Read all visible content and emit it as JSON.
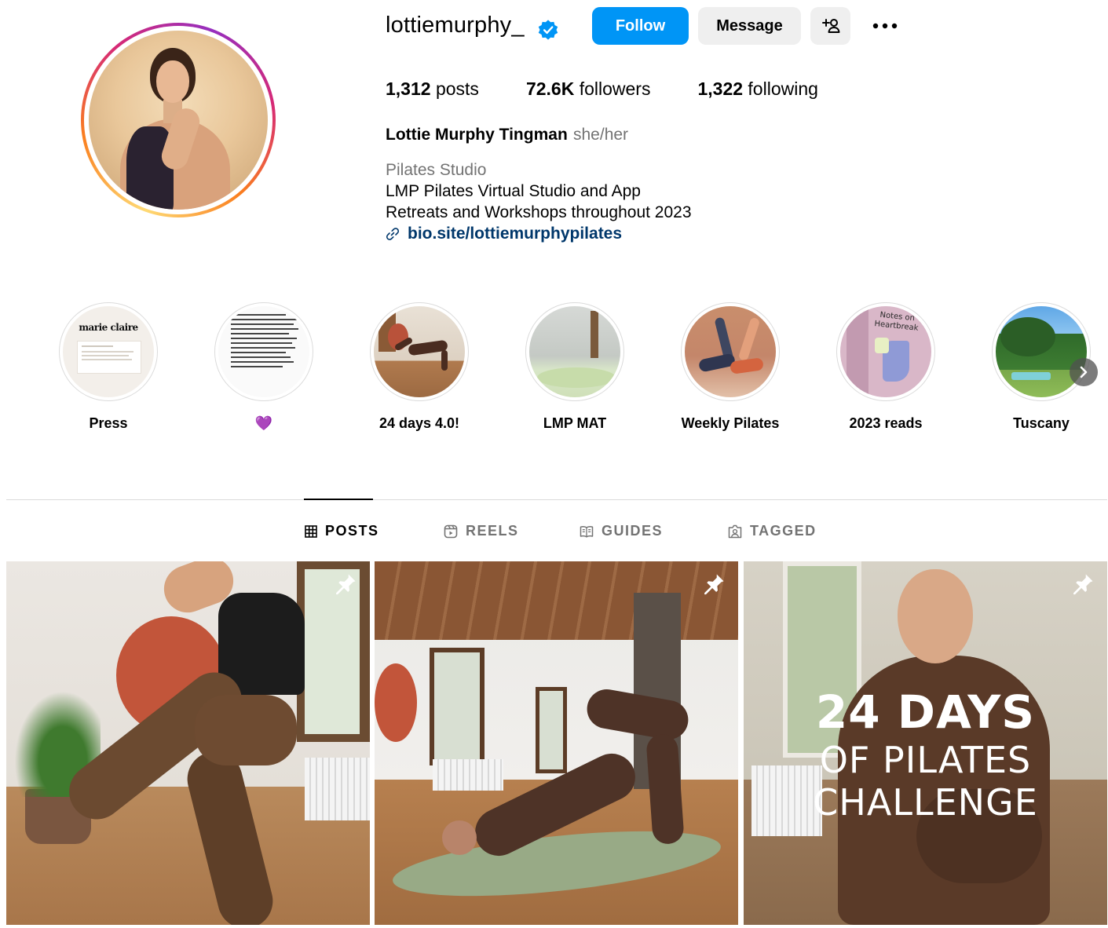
{
  "profile": {
    "username": "lottiemurphy_",
    "verified": true,
    "follow_label": "Follow",
    "message_label": "Message",
    "stats": {
      "posts_count": "1,312",
      "posts_label": "posts",
      "followers_count": "72.6K",
      "followers_label": "followers",
      "following_count": "1,322",
      "following_label": "following"
    },
    "full_name": "Lottie Murphy Tingman",
    "pronouns": "she/her",
    "category": "Pilates Studio",
    "bio_lines": [
      "LMP Pilates Virtual Studio and App",
      "Retreats and Workshops throughout 2023"
    ],
    "link": "bio.site/lottiemurphypilates"
  },
  "highlights": [
    {
      "label": "Press"
    },
    {
      "label": "💜"
    },
    {
      "label": "24 days 4.0!"
    },
    {
      "label": "LMP MAT"
    },
    {
      "label": "Weekly Pilates"
    },
    {
      "label": "2023 reads"
    },
    {
      "label": "Tuscany"
    }
  ],
  "highlight_art": {
    "press_logo": "marie claire",
    "notes_book": "Notes on Heartbreak"
  },
  "tabs": [
    {
      "label": "POSTS",
      "icon": "grid-icon",
      "active": true
    },
    {
      "label": "REELS",
      "icon": "reels-icon",
      "active": false
    },
    {
      "label": "GUIDES",
      "icon": "guides-icon",
      "active": false
    },
    {
      "label": "TAGGED",
      "icon": "tagged-icon",
      "active": false
    }
  ],
  "posts": [
    {
      "pinned": true
    },
    {
      "pinned": true
    },
    {
      "pinned": true,
      "overlay": {
        "line1": "24 DAYS",
        "line2": "OF PILATES",
        "line3": "CHALLENGE"
      }
    }
  ],
  "colors": {
    "accent": "#0095f6",
    "link": "#00376b",
    "secondary_text": "#737373",
    "button_grey": "#efefef"
  }
}
